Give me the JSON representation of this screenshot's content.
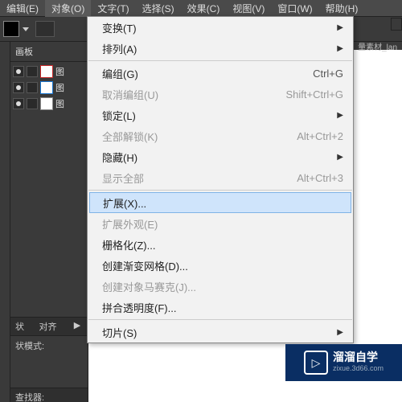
{
  "menubar": {
    "edit": "编辑(E)",
    "object": "对象(O)",
    "text": "文字(T)",
    "select": "选择(S)",
    "effect": "效果(C)",
    "view": "视图(V)",
    "window": "窗口(W)",
    "help": "帮助(H)"
  },
  "leftpanel": {
    "title": "画板",
    "layers": [
      {
        "id": 1,
        "name": "图"
      },
      {
        "id": 2,
        "name": "图"
      },
      {
        "id": 3,
        "name": "图"
      }
    ]
  },
  "bottompanels": {
    "tab_transform": "状",
    "tab_align": "对齐",
    "tab_arrow": "▶",
    "shape_label": "状模式:"
  },
  "finder_label": "查找器:",
  "tabbar_text": "量素材_lan",
  "dropdown": {
    "transform": "变换(T)",
    "arrange": "排列(A)",
    "group": {
      "label": "编组(G)",
      "shortcut": "Ctrl+G"
    },
    "ungroup": {
      "label": "取消编组(U)",
      "shortcut": "Shift+Ctrl+G"
    },
    "lock": "锁定(L)",
    "unlockall": {
      "label": "全部解锁(K)",
      "shortcut": "Alt+Ctrl+2"
    },
    "hide": "隐藏(H)",
    "showall": {
      "label": "显示全部",
      "shortcut": "Alt+Ctrl+3"
    },
    "expand": "扩展(X)...",
    "expandappearance": "扩展外观(E)",
    "rasterize": "栅格化(Z)...",
    "gradientmesh": "创建渐变网格(D)...",
    "mosaic": "创建对象马赛克(J)...",
    "flatten": "拼合透明度(F)...",
    "slice": "切片(S)"
  },
  "watermark": {
    "brand": "溜溜自学",
    "url": "zixue.3d66.com",
    "icon": "▷"
  }
}
